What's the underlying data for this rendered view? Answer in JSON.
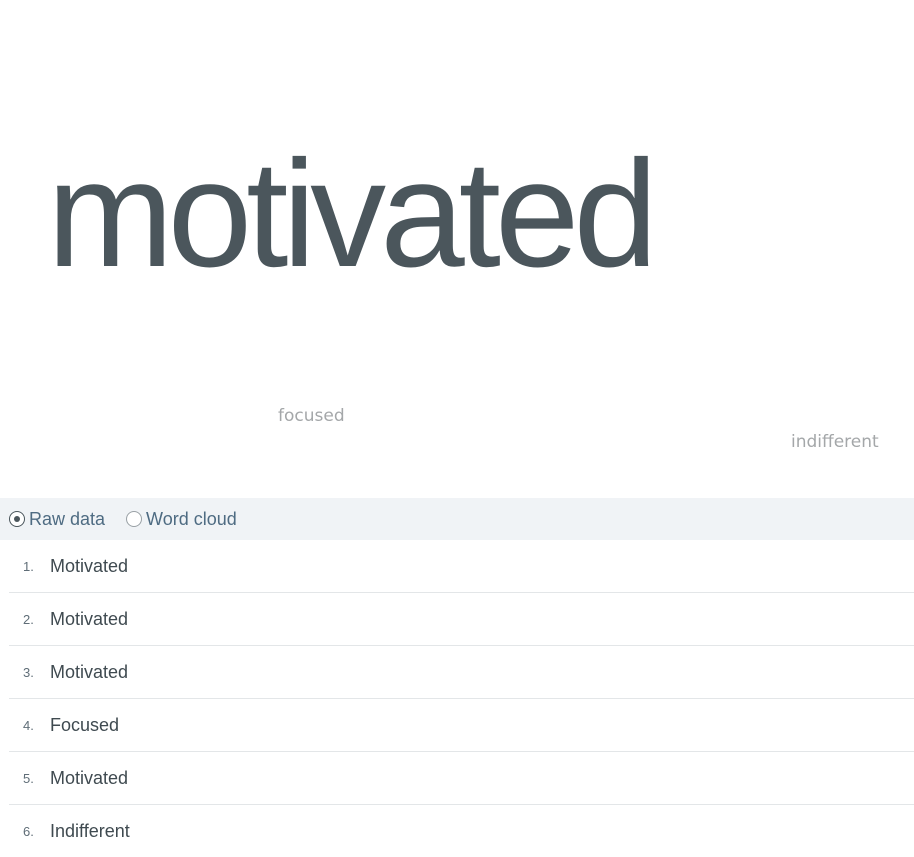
{
  "word_cloud": {
    "words": [
      {
        "text": "motivated",
        "weight": "large"
      },
      {
        "text": "focused",
        "weight": "small"
      },
      {
        "text": "indifferent",
        "weight": "small"
      }
    ]
  },
  "view_toggle": {
    "options": [
      {
        "label": "Raw data",
        "selected": true
      },
      {
        "label": "Word cloud",
        "selected": false
      }
    ]
  },
  "responses": [
    {
      "num": "1.",
      "text": "Motivated"
    },
    {
      "num": "2.",
      "text": "Motivated"
    },
    {
      "num": "3.",
      "text": "Motivated"
    },
    {
      "num": "4.",
      "text": "Focused"
    },
    {
      "num": "5.",
      "text": "Motivated"
    },
    {
      "num": "6.",
      "text": "Indifferent"
    }
  ],
  "colors": {
    "big_word": "#4b565c",
    "small_word": "#a4a7a9",
    "toggle_bg": "#f0f3f6",
    "toggle_label": "#4e6b82",
    "row_text": "#3f4a50",
    "divider": "#e3e6e8"
  }
}
